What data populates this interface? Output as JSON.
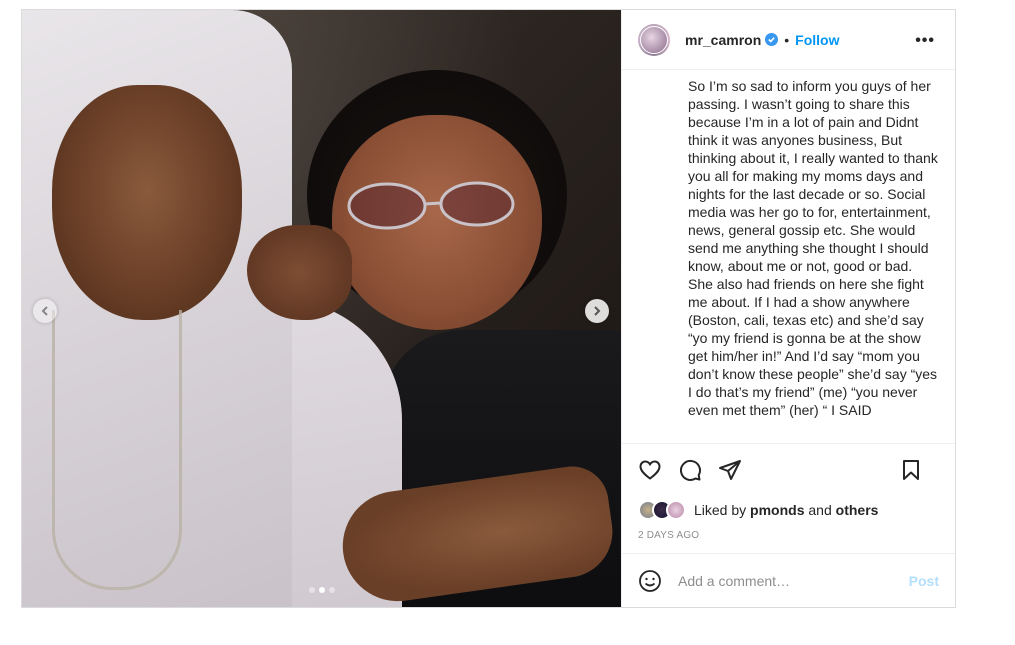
{
  "header": {
    "username": "mr_camron",
    "separator": "•",
    "follow_label": "Follow",
    "more_label": "•••"
  },
  "caption": {
    "text": "So I’m so sad to inform you guys of her passing. I wasn’t going to share this because I’m in a lot of pain and Didnt think it was anyones business, But thinking about it, I really wanted to thank you all for making my moms days and nights for the last decade or so. Social media was her go to for, entertainment, news, general gossip etc. She would send me anything she thought I should know, about me or not, good or bad. She also had friends on here she fight me about. If I had a show anywhere (Boston, cali, texas etc) and she’d say “yo my friend is gonna be at the show get him/her in!” And I’d say “mom you don’t know these people” she’d say “yes I do that’s my friend” (me) “you never even met them” (her) “ I SAID"
  },
  "media": {
    "slide_count": 3,
    "active_slide": 2
  },
  "likes": {
    "prefix": "Liked by ",
    "user": "pmonds",
    "middle": " and ",
    "others": "others"
  },
  "date": "2 days ago",
  "comment": {
    "placeholder": "Add a comment…",
    "post_label": "Post"
  },
  "colors": {
    "accent": "#0095f6",
    "post_disabled": "#b2dffc",
    "verified": "#3897f0"
  }
}
